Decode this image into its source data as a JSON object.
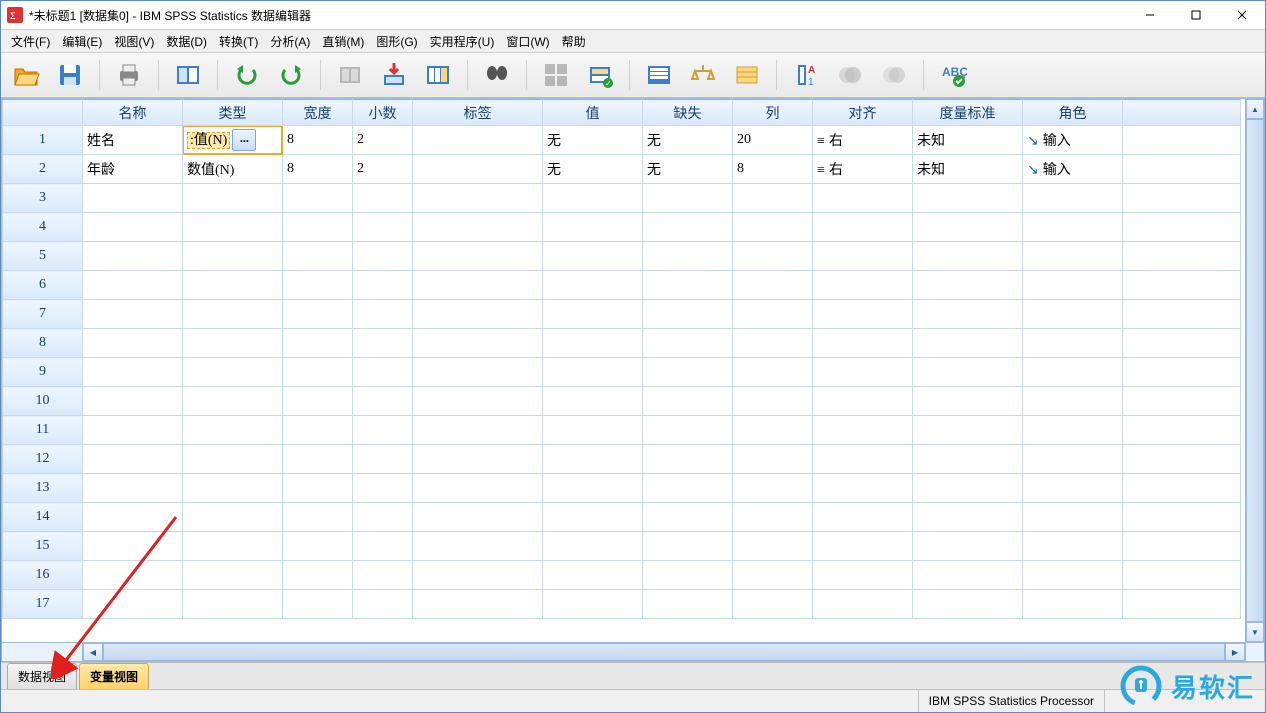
{
  "title": "*未标题1 [数据集0] - IBM SPSS Statistics 数据编辑器",
  "menu": [
    "文件(F)",
    "编辑(E)",
    "视图(V)",
    "数据(D)",
    "转换(T)",
    "分析(A)",
    "直销(M)",
    "图形(G)",
    "实用程序(U)",
    "窗口(W)",
    "帮助"
  ],
  "headers": [
    "名称",
    "类型",
    "宽度",
    "小数",
    "标签",
    "值",
    "缺失",
    "列",
    "对齐",
    "度量标准",
    "角色"
  ],
  "rows": [
    {
      "n": 1,
      "name": "姓名",
      "type": ":值(N)",
      "type_active": true,
      "width": "8",
      "dec": "2",
      "label": "",
      "values": "无",
      "missing": "无",
      "cols": "20",
      "align": "右",
      "measure": "未知",
      "role": "输入"
    },
    {
      "n": 2,
      "name": "年龄",
      "type": "数值(N)",
      "type_active": false,
      "width": "8",
      "dec": "2",
      "label": "",
      "values": "无",
      "missing": "无",
      "cols": "8",
      "align": "右",
      "measure": "未知",
      "role": "输入"
    }
  ],
  "empty_rows": [
    3,
    4,
    5,
    6,
    7,
    8,
    9,
    10,
    11,
    12,
    13,
    14,
    15,
    16,
    17
  ],
  "tabs": {
    "data": "数据视图",
    "var": "变量视图",
    "active": "var"
  },
  "status": "IBM SPSS Statistics Processor",
  "watermark": "易软汇",
  "dots": "..."
}
